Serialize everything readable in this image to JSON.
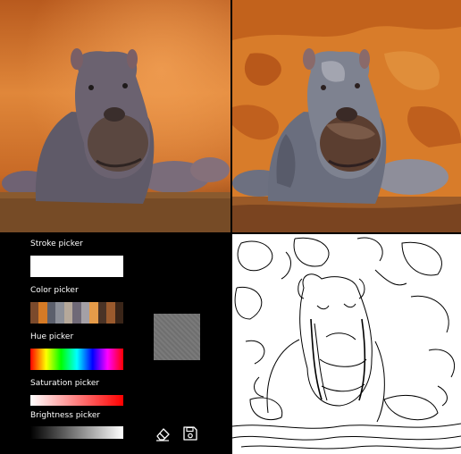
{
  "app": {
    "panels": {
      "original_image": "hippo-photo",
      "posterized_image": "hippo-posterized",
      "edge_image": "hippo-edge-detected"
    }
  },
  "controls": {
    "stroke_label": "Stroke picker",
    "color_label": "Color picker",
    "hue_label": "Hue picker",
    "saturation_label": "Saturation picker",
    "brightness_label": "Brightness picker",
    "stroke_color": "#ffffff",
    "palette": [
      "#7b4a2c",
      "#d47a26",
      "#5b5f6c",
      "#8c8f98",
      "#b5a89a",
      "#6f6977",
      "#a4a0a6",
      "#e59b49",
      "#4a3326",
      "#9a5a2d",
      "#3a2518"
    ],
    "selected_color": "#787878",
    "tools": [
      "eraser-icon",
      "save-icon"
    ]
  }
}
